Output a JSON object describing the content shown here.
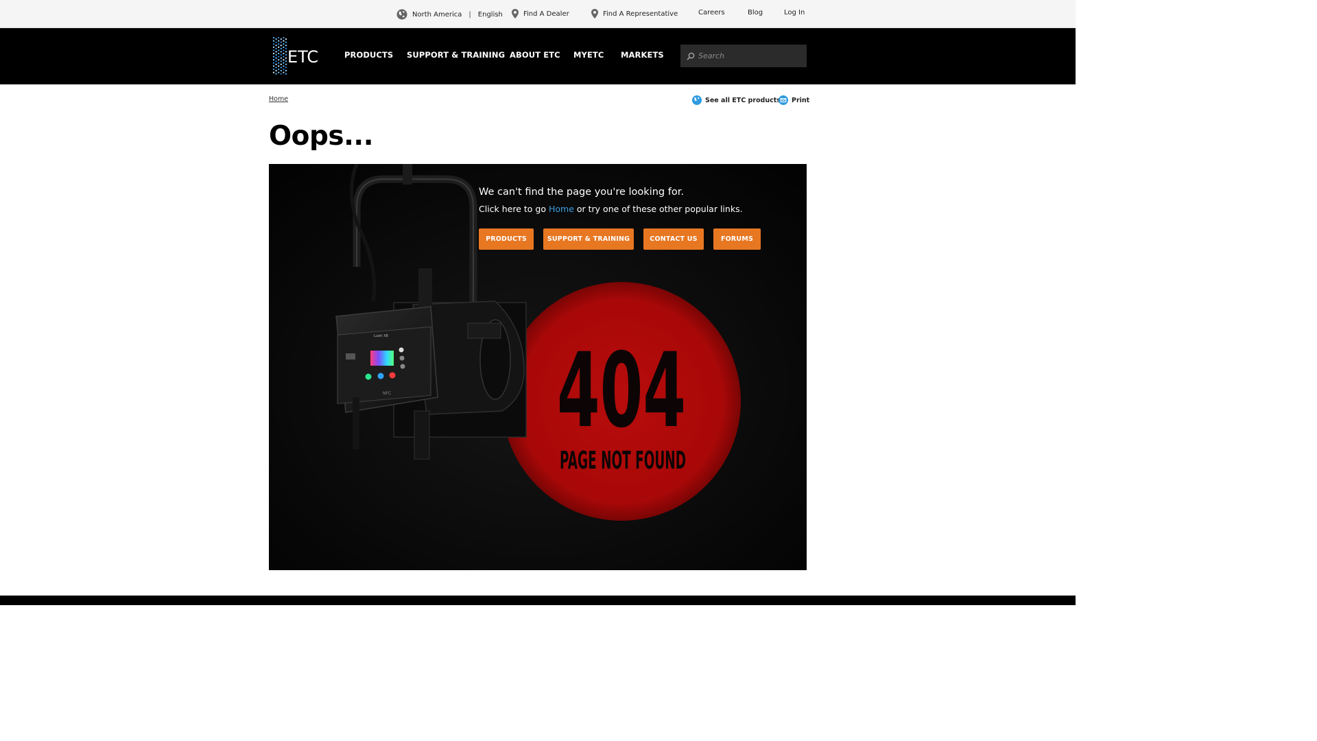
{
  "utility": {
    "region": "North America",
    "language": "English",
    "separator": "|",
    "find_dealer": "Find A Dealer",
    "find_rep": "Find A Representative",
    "careers": "Careers",
    "blog": "Blog",
    "login": "Log In",
    "icons": [
      "globe-icon",
      "map-pin-icon",
      "map-pin-icon"
    ]
  },
  "nav": {
    "items": [
      {
        "label": "PRODUCTS"
      },
      {
        "label": "SUPPORT & TRAINING"
      },
      {
        "label": "ABOUT ETC"
      },
      {
        "label": "MYETC"
      },
      {
        "label": "MARKETS"
      }
    ],
    "search_placeholder": "Search",
    "logo_text": "ETC"
  },
  "breadcrumb": {
    "home": "Home"
  },
  "tools": {
    "see_all": "See all ETC products",
    "print": "Print"
  },
  "page": {
    "title": "Oops..."
  },
  "hero": {
    "headline": "We can't find the page you're looking for.",
    "line_before": "Click here to go ",
    "home_link": "Home",
    "line_after": " or try one of these other popular links.",
    "buttons": [
      {
        "label": "PRODUCTS"
      },
      {
        "label": "SUPPORT & TRAINING"
      },
      {
        "label": "CONTACT US"
      },
      {
        "label": "FORUMS"
      }
    ],
    "error_code": "404",
    "error_text": "PAGE NOT FOUND",
    "fixture_label": "Lustr X8",
    "fixture_nfc": "NFC"
  },
  "colors": {
    "accent_orange": "#e87722",
    "link_blue": "#3d9fe0",
    "circle_red": "#b30a0a",
    "nav_bg": "#000000"
  }
}
